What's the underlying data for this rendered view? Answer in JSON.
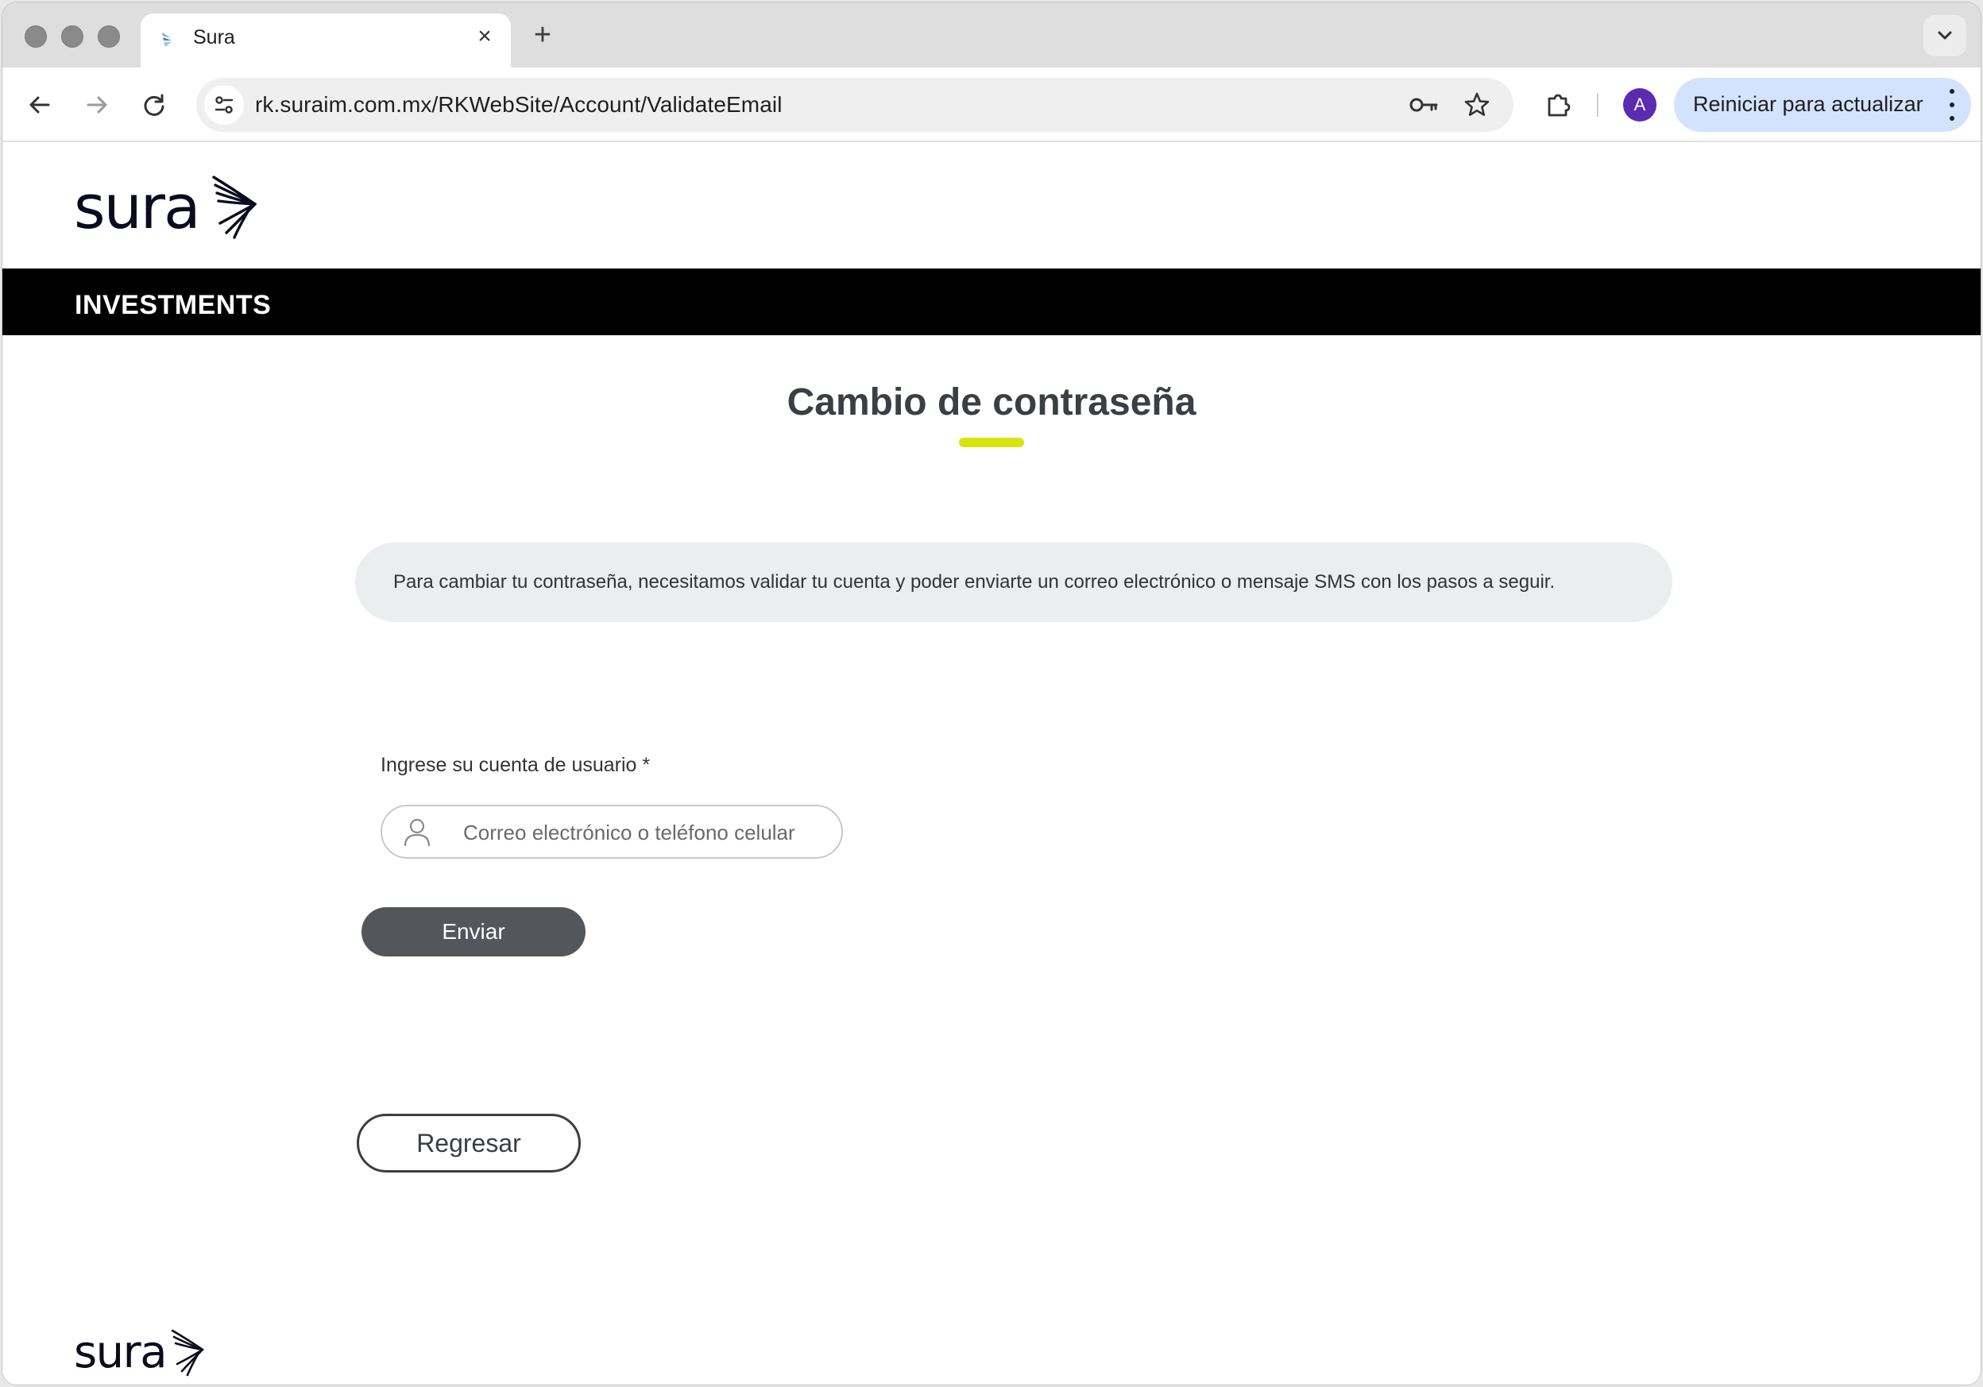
{
  "browser": {
    "tab_title": "Sura",
    "url": "rk.suraim.com.mx/RKWebSite/Account/ValidateEmail",
    "update_button_label": "Reiniciar para actualizar",
    "profile_initial": "A"
  },
  "header": {
    "brand": "sura",
    "section_label": "INVESTMENTS"
  },
  "main": {
    "title_bold": "Cambio",
    "title_rest": " de contraseña",
    "info_text": "Para cambiar tu contraseña, necesitamos validar tu cuenta y poder enviarte un correo electrónico o mensaje SMS con los pasos a seguir.",
    "field_label": "Ingrese su cuenta de usuario *",
    "field_placeholder": "Correo electrónico o teléfono celular",
    "send_label": "Enviar",
    "back_label": "Regresar"
  },
  "footer": {
    "brand": "sura"
  },
  "colors": {
    "accent": "#d8e40f",
    "primary_button": "#53565a",
    "info_box": "#eaeeee",
    "header_bar": "#000000",
    "profile": "#5b2bb0",
    "update_button": "#d3e3fd"
  }
}
